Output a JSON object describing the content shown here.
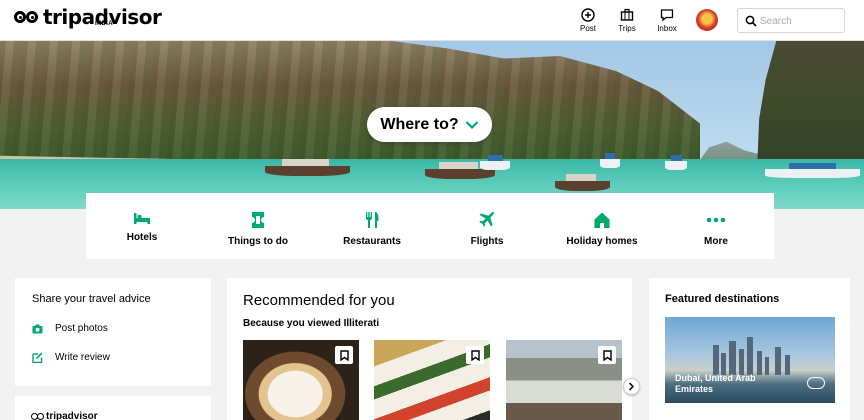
{
  "brand": {
    "name": "tripadvisor",
    "region": "INDIA"
  },
  "header": {
    "nav": [
      {
        "label": "Post",
        "icon": "plus-circle-icon"
      },
      {
        "label": "Trips",
        "icon": "briefcase-icon"
      },
      {
        "label": "Inbox",
        "icon": "chat-bubble-icon"
      }
    ],
    "search": {
      "placeholder": "Search"
    }
  },
  "hero": {
    "cta_label": "Where to?"
  },
  "categories": [
    {
      "label": "Hotels",
      "icon": "bed-icon"
    },
    {
      "label": "Things to do",
      "icon": "ticket-icon"
    },
    {
      "label": "Restaurants",
      "icon": "fork-knife-icon"
    },
    {
      "label": "Flights",
      "icon": "airplane-icon"
    },
    {
      "label": "Holiday homes",
      "icon": "house-icon"
    },
    {
      "label": "More",
      "icon": "more-dots-icon"
    }
  ],
  "share": {
    "title": "Share your travel advice",
    "actions": [
      {
        "label": "Post photos",
        "icon": "camera-icon"
      },
      {
        "label": "Write review",
        "icon": "edit-icon"
      }
    ]
  },
  "recommended": {
    "title": "Recommended for you",
    "subtitle": "Because you viewed Illiterati"
  },
  "featured": {
    "title": "Featured destinations",
    "destination": "Dubai, United Arab Emirates"
  },
  "colors": {
    "accent": "#00aa6c",
    "text": "#000000",
    "background": "#f2f2f2"
  }
}
